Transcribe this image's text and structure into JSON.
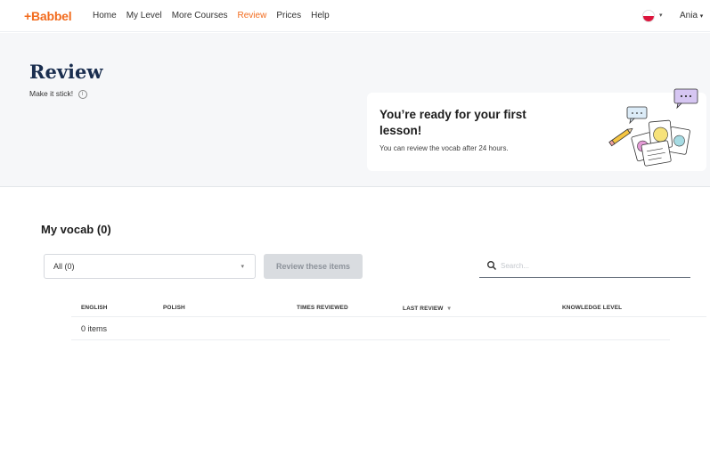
{
  "nav": {
    "logo": "+Babbel",
    "links": [
      "Home",
      "My Level",
      "More Courses",
      "Review",
      "Prices",
      "Help"
    ],
    "active_link": "Review",
    "user_name": "Ania",
    "caret": "▾",
    "flag": "polish-flag-icon"
  },
  "header": {
    "title": "Review",
    "subtitle": "Make it stick!",
    "info_icon": "i"
  },
  "card": {
    "title": "You’re ready for your first lesson!",
    "text": "You can review the vocab after 24 hours."
  },
  "vocab": {
    "title": "My vocab (0)",
    "filter_value": "All (0)",
    "review_button": "Review these items",
    "search_placeholder": "Search...",
    "columns": {
      "english": "ENGLISH",
      "polish": "POLISH",
      "times_reviewed": "TIMES REVIEWED",
      "last_review": "LAST REVIEW",
      "last_review_sort": "▾",
      "knowledge_level": "KNOWLEDGE LEVEL"
    },
    "row_text": "0 items"
  },
  "colors": {
    "brand": "#f26b1d",
    "title": "#1a2e4f",
    "header_bg": "#f6f7f9",
    "button_disabled": "#d9dce0"
  }
}
